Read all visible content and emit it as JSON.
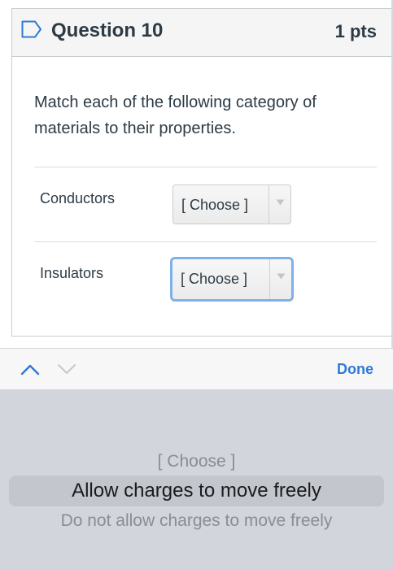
{
  "question": {
    "title": "Question 10",
    "points": "1 pts",
    "text": "Match each of the following category of materials to their properties."
  },
  "matches": [
    {
      "label": "Conductors",
      "selected_value": "[ Choose ]"
    },
    {
      "label": "Insulators",
      "selected_value": "[ Choose ]"
    }
  ],
  "keyboard_bar": {
    "done_label": "Done",
    "up_icon": "chevron-up-icon",
    "down_icon": "chevron-down-icon"
  },
  "picker": {
    "options": [
      "[ Choose ]",
      "Allow charges to move freely",
      "Do not allow charges to move freely"
    ],
    "selected_index": 1
  },
  "colors": {
    "accent": "#2f7ad6",
    "focus_ring": "#7fb1e8",
    "text": "#2d3b45",
    "picker_background": "#d2d5db"
  }
}
